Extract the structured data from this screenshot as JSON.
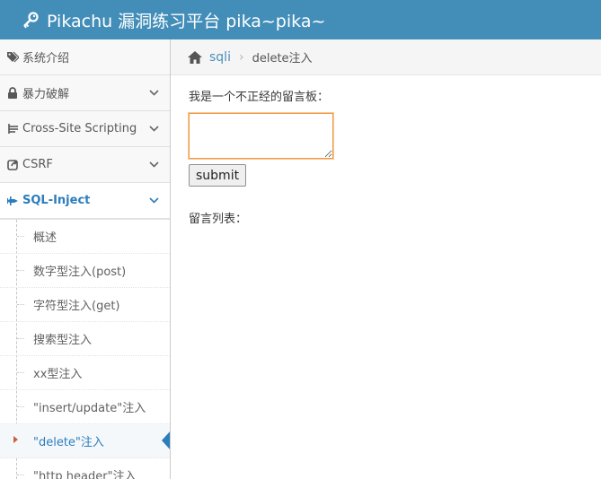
{
  "navbar": {
    "brand": "Pikachu 漏洞练习平台 pika~pika~",
    "icon": "key-icon"
  },
  "sidebar": {
    "items": [
      {
        "label": "系统介绍",
        "icon": "tags-icon"
      },
      {
        "label": "暴力破解",
        "icon": "lock-icon"
      },
      {
        "label": "Cross-Site Scripting",
        "icon": "list-tree-icon"
      },
      {
        "label": "CSRF",
        "icon": "share-icon"
      },
      {
        "label": "SQL-Inject",
        "icon": "fighter-jet-icon"
      }
    ],
    "submenu": [
      {
        "label": "概述"
      },
      {
        "label": "数字型注入(post)"
      },
      {
        "label": "字符型注入(get)"
      },
      {
        "label": "搜索型注入"
      },
      {
        "label": "xx型注入"
      },
      {
        "label": "\"insert/update\"注入"
      },
      {
        "label": "\"delete\"注入"
      },
      {
        "label": "\"http header\"注入"
      }
    ]
  },
  "breadcrumb": {
    "link": "sqli",
    "separator": "›",
    "current": "delete注入"
  },
  "main": {
    "prompt": "我是一个不正经的留言板：",
    "textarea_value": "",
    "submit_label": "submit",
    "list_label": "留言列表："
  },
  "colors": {
    "navbar": "#438eb9",
    "accent": "#2b7dbc",
    "focus_border": "#f59942"
  }
}
